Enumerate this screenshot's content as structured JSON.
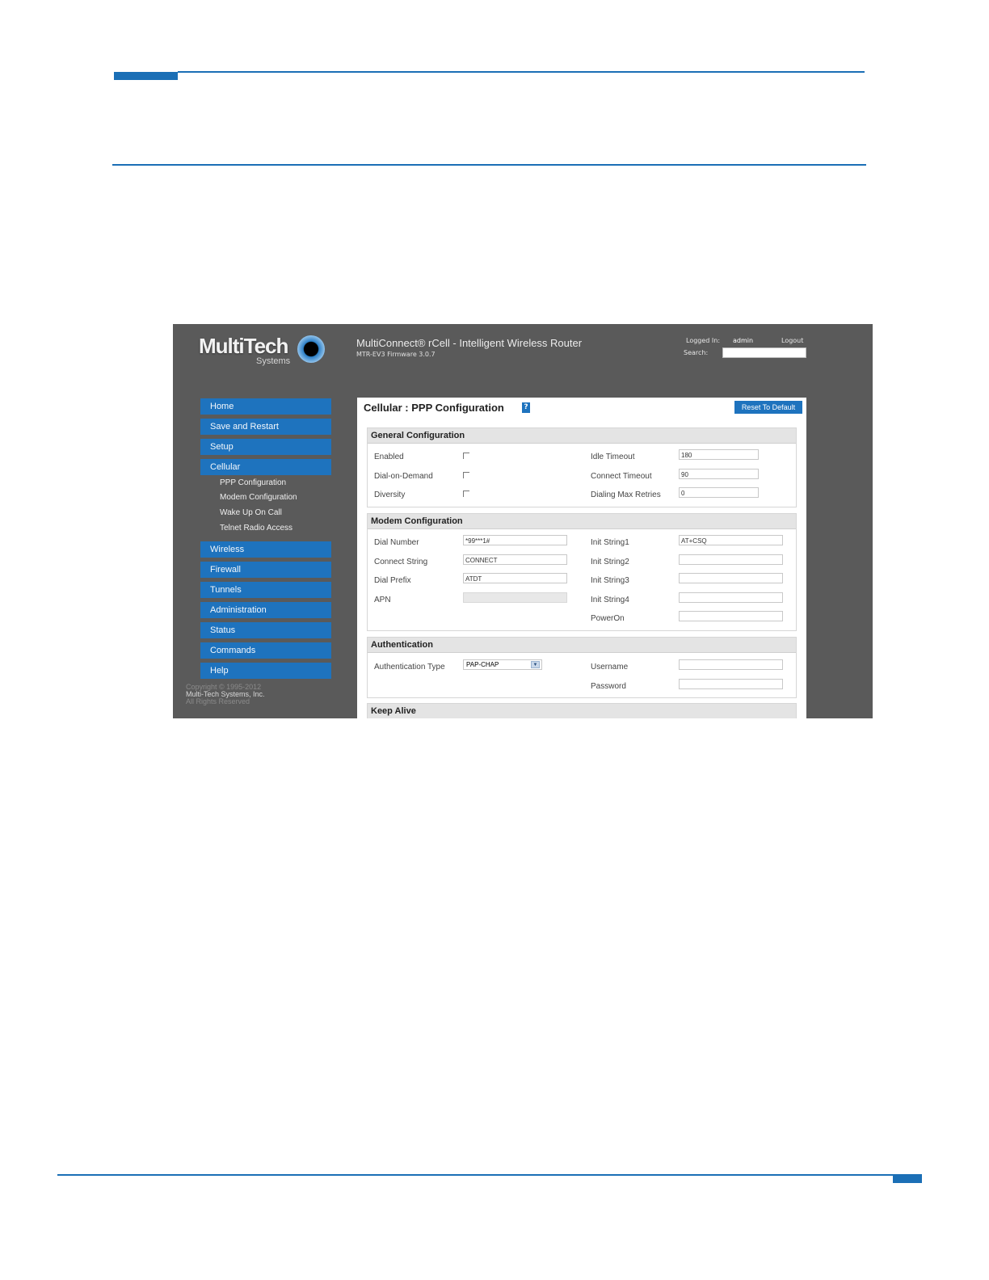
{
  "header": {
    "app_title": "MultiConnect® rCell - Intelligent Wireless Router",
    "app_sub": "MTR-EV3   Firmware 3.0.7",
    "logo_main": "MultiTech",
    "logo_sub": "Systems",
    "logged_in_label": "Logged In:",
    "logged_in_user": "admin",
    "logout_label": "Logout",
    "search_label": "Search:",
    "search_value": ""
  },
  "sidebar": {
    "items": [
      {
        "label": "Home"
      },
      {
        "label": "Save and Restart"
      },
      {
        "label": "Setup"
      },
      {
        "label": "Cellular"
      },
      {
        "label": "Wireless"
      },
      {
        "label": "Firewall"
      },
      {
        "label": "Tunnels"
      },
      {
        "label": "Administration"
      },
      {
        "label": "Status"
      },
      {
        "label": "Commands"
      },
      {
        "label": "Help"
      }
    ],
    "cellular_sub": [
      {
        "label": "PPP Configuration"
      },
      {
        "label": "Modem Configuration"
      },
      {
        "label": "Wake Up On Call"
      },
      {
        "label": "Telnet Radio Access"
      }
    ],
    "copyright_1": "Copyright © 1995-2012",
    "copyright_2": "Multi-Tech Systems, Inc.",
    "copyright_3": "All Rights Reserved"
  },
  "panel": {
    "title": "Cellular : PPP Configuration",
    "help_glyph": "?",
    "reset_label": "Reset To Default"
  },
  "general": {
    "heading": "General Configuration",
    "enabled_label": "Enabled",
    "dod_label": "Dial-on-Demand",
    "diversity_label": "Diversity",
    "idle_label": "Idle Timeout",
    "idle_value": "180",
    "connect_timeout_label": "Connect Timeout",
    "connect_timeout_value": "90",
    "retries_label": "Dialing Max Retries",
    "retries_value": "0"
  },
  "modem": {
    "heading": "Modem Configuration",
    "dial_number_label": "Dial Number",
    "dial_number_value": "*99***1#",
    "connect_string_label": "Connect String",
    "connect_string_value": "CONNECT",
    "dial_prefix_label": "Dial Prefix",
    "dial_prefix_value": "ATDT",
    "apn_label": "APN",
    "init1_label": "Init String1",
    "init1_value": "AT+CSQ",
    "init2_label": "Init String2",
    "init3_label": "Init String3",
    "init4_label": "Init String4",
    "poweron_label": "PowerOn"
  },
  "auth": {
    "heading": "Authentication",
    "type_label": "Authentication Type",
    "type_value": "PAP-CHAP",
    "username_label": "Username",
    "password_label": "Password"
  },
  "keepalive": {
    "heading": "Keep Alive"
  }
}
